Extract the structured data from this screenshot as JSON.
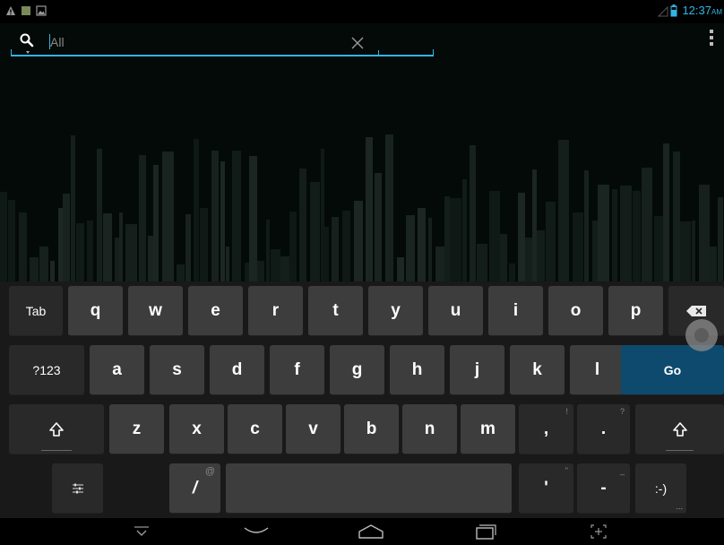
{
  "status_bar": {
    "time": "12:37",
    "ampm": "AM",
    "icons": [
      "warning-icon",
      "notification-square-icon",
      "gallery-icon",
      "signal-icon",
      "battery-icon"
    ]
  },
  "search": {
    "query_placeholder": "All",
    "clear_icon": "close-icon",
    "overflow_icon": "overflow-menu-icon",
    "search_icon": "search-icon"
  },
  "keyboard": {
    "row1": [
      "Tab",
      "q",
      "w",
      "e",
      "r",
      "t",
      "y",
      "u",
      "i",
      "o",
      "p"
    ],
    "row1_backspace_icon": "backspace-icon",
    "row2": [
      "?123",
      "a",
      "s",
      "d",
      "f",
      "g",
      "h",
      "j",
      "k",
      "l",
      "Go"
    ],
    "row3": [
      "z",
      "x",
      "c",
      "v",
      "b",
      "n",
      "m",
      ",",
      "."
    ],
    "row3_hints": {
      "comma": "!",
      "period": "?"
    },
    "shift_icon": "shift-icon",
    "row4": {
      "settings_icon": "settings-sliders-icon",
      "slash": "/",
      "slash_hint": "@",
      "apostrophe": "'",
      "apostrophe_hint": "\"",
      "dash": "-",
      "dash_hint": "_",
      "smiley": ":-)",
      "smiley_hint": "..."
    }
  },
  "nav_bar": {
    "icons": [
      "hide-keyboard-icon",
      "back-icon",
      "home-icon",
      "recent-apps-icon",
      "screenshot-icon"
    ]
  },
  "colors": {
    "accent": "#33b5e5",
    "key": "#3d3d3d",
    "key_dark": "#292929",
    "go_key": "#0e4a6e",
    "background": "#030806"
  }
}
